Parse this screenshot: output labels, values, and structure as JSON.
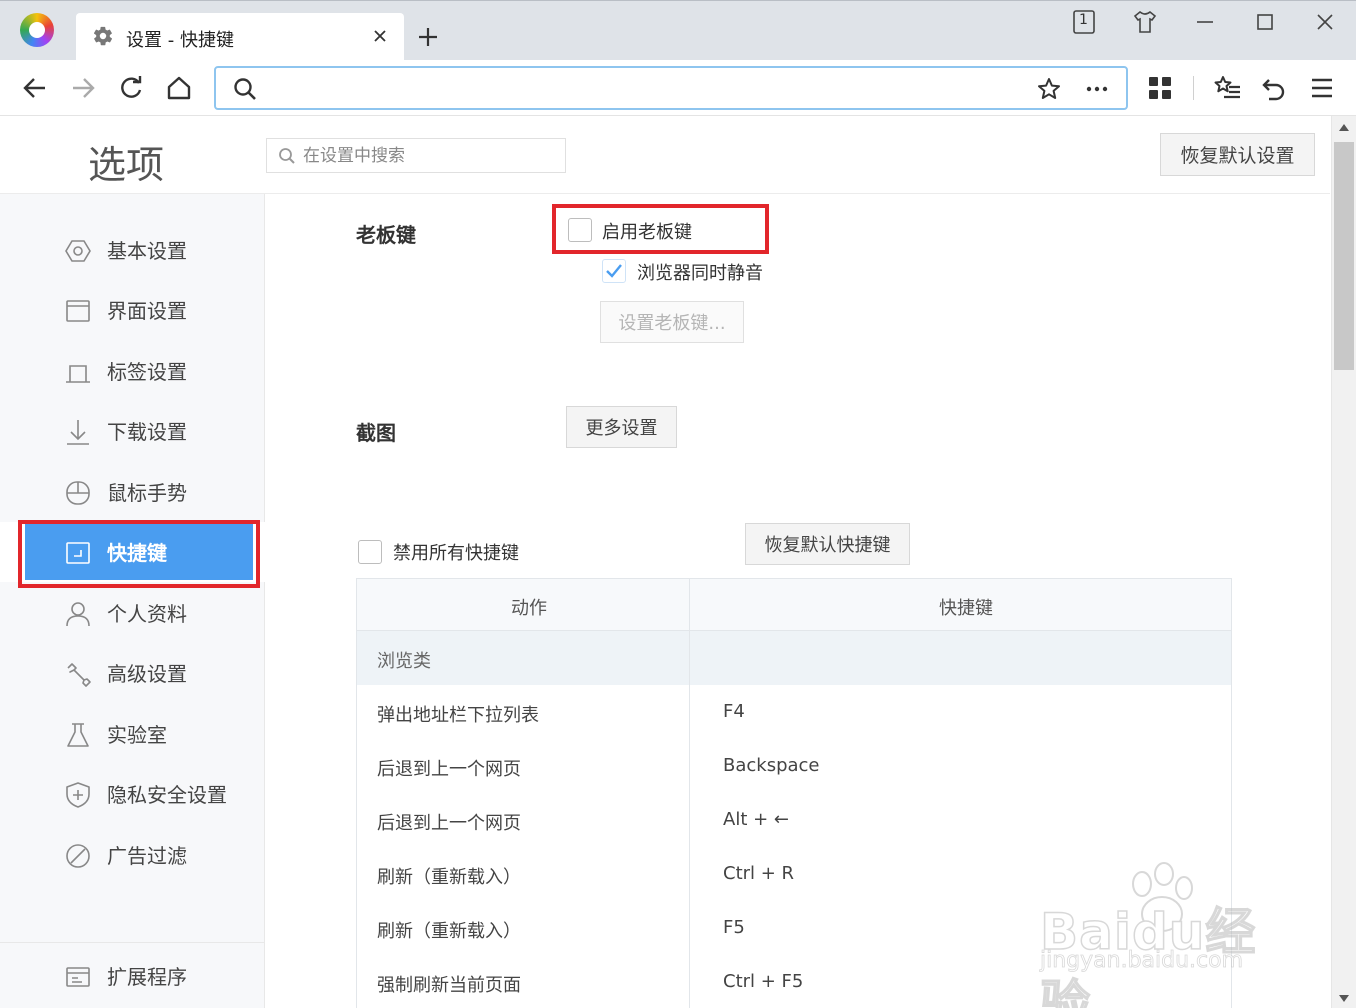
{
  "browser": {
    "tab_title": "设置 - 快捷键",
    "window_badge": "1",
    "address_value": ""
  },
  "header": {
    "title": "选项",
    "search_placeholder": "在设置中搜索",
    "restore_defaults": "恢复默认设置"
  },
  "sidebar": {
    "items": [
      {
        "label": "基本设置",
        "icon": "hexagon-settings-icon"
      },
      {
        "label": "界面设置",
        "icon": "window-icon"
      },
      {
        "label": "标签设置",
        "icon": "tab-icon"
      },
      {
        "label": "下载设置",
        "icon": "download-icon"
      },
      {
        "label": "鼠标手势",
        "icon": "mouse-icon"
      },
      {
        "label": "快捷键",
        "icon": "keyboard-shortcut-icon",
        "active": true
      },
      {
        "label": "个人资料",
        "icon": "user-icon"
      },
      {
        "label": "高级设置",
        "icon": "wrench-icon"
      },
      {
        "label": "实验室",
        "icon": "flask-icon"
      },
      {
        "label": "隐私安全设置",
        "icon": "shield-plus-icon"
      },
      {
        "label": "广告过滤",
        "icon": "block-icon"
      }
    ],
    "extensions": "扩展程序"
  },
  "boss_key": {
    "section": "老板键",
    "enable_label": "启用老板键",
    "enable_checked": false,
    "mute_label": "浏览器同时静音",
    "mute_checked": true,
    "set_button": "设置老板键..."
  },
  "screenshot": {
    "section": "截图",
    "more_button": "更多设置"
  },
  "shortcuts": {
    "disable_all_label": "禁用所有快捷键",
    "disable_all_checked": false,
    "restore_button": "恢复默认快捷键",
    "columns": [
      "动作",
      "快捷键"
    ],
    "group": "浏览类",
    "rows": [
      {
        "action": "弹出地址栏下拉列表",
        "key": "F4"
      },
      {
        "action": "后退到上一个网页",
        "key": "Backspace"
      },
      {
        "action": "后退到上一个网页",
        "key": "Alt + ←"
      },
      {
        "action": "刷新（重新载入）",
        "key": "Ctrl + R"
      },
      {
        "action": "刷新（重新载入）",
        "key": "F5"
      },
      {
        "action": "强制刷新当前页面",
        "key": "Ctrl + F5"
      }
    ]
  },
  "watermark": {
    "main": "Baidu经验",
    "sub": "jingyan.baidu.com"
  },
  "colors": {
    "accent": "#4a9df0",
    "highlight": "#e2262b",
    "address_border": "#8ec5ef"
  }
}
